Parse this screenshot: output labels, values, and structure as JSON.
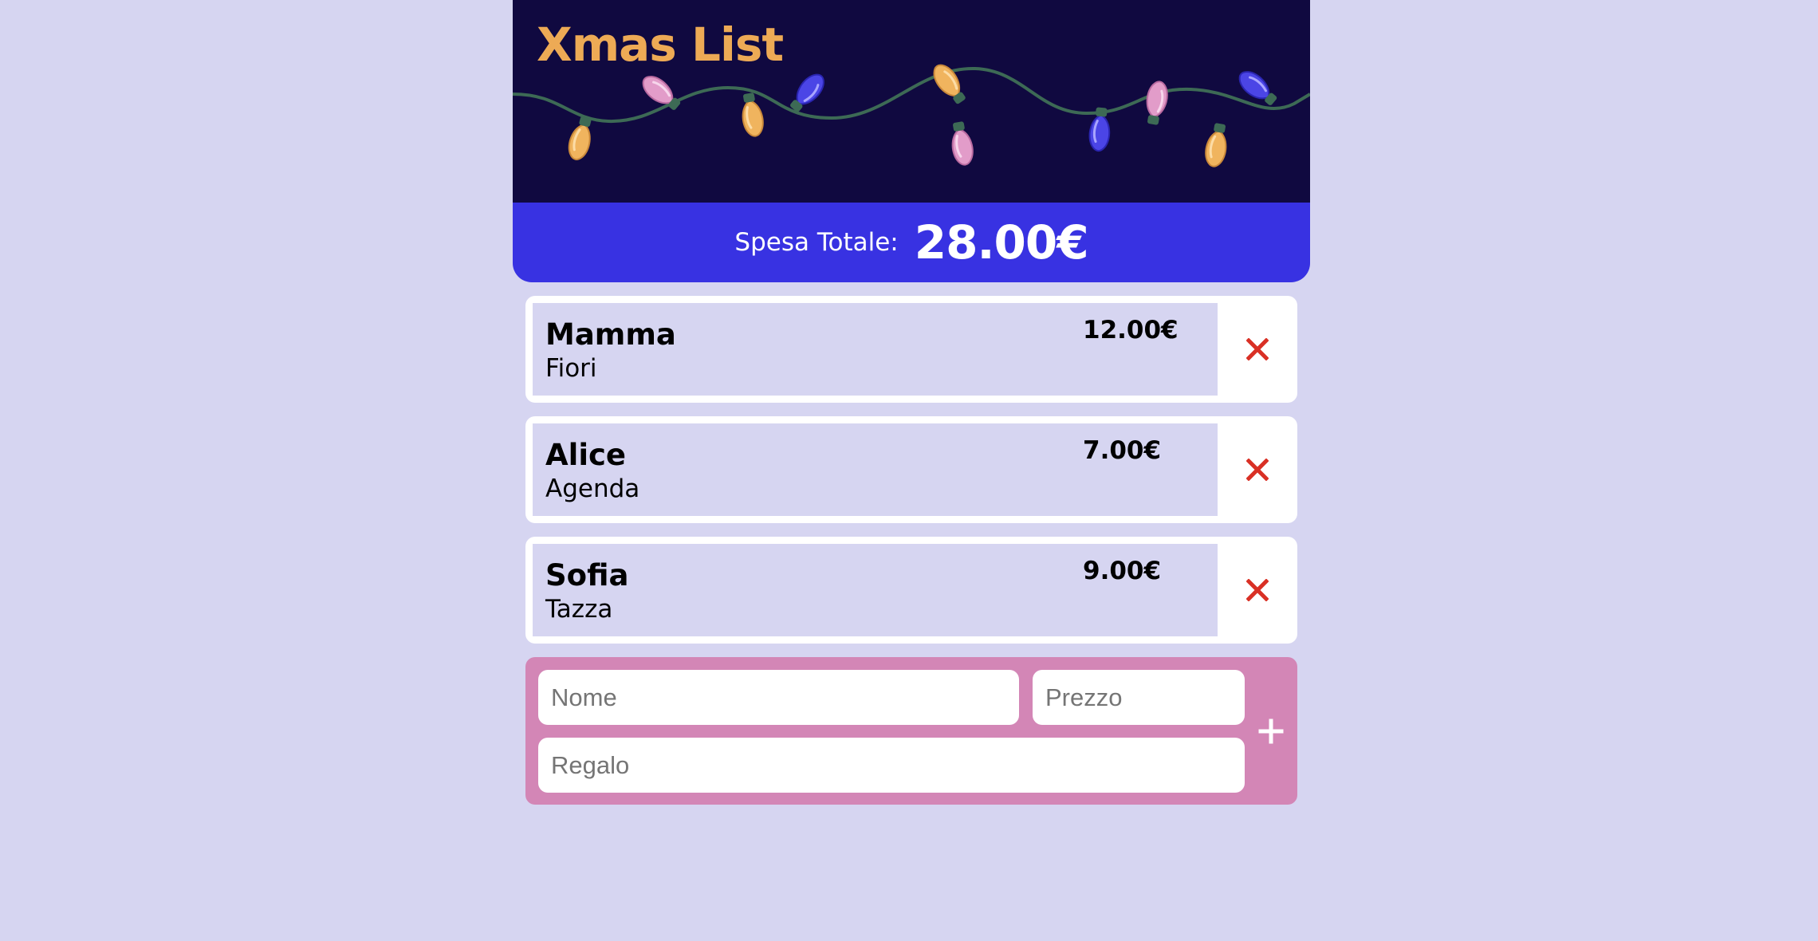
{
  "app": {
    "title": "Xmas List"
  },
  "total": {
    "label": "Spesa Totale:",
    "value": "28.00€"
  },
  "items": [
    {
      "name": "Mamma",
      "gift": "Fiori",
      "price": "12.00€"
    },
    {
      "name": "Alice",
      "gift": "Agenda",
      "price": "7.00€"
    },
    {
      "name": "Sofia",
      "gift": "Tazza",
      "price": "9.00€"
    }
  ],
  "form": {
    "name_placeholder": "Nome",
    "price_placeholder": "Prezzo",
    "gift_placeholder": "Regalo",
    "add_icon": "plus-icon"
  },
  "icons": {
    "delete": "close-icon",
    "add": "plus-icon"
  },
  "colors": {
    "page_background": "#d6d5f1",
    "header_background": "#100940",
    "title": "#edaa55",
    "total_bar": "#3832e2",
    "form_background": "#d386b6",
    "delete_icon": "#d93025",
    "wire": "#3d6a55",
    "bulb_yellow": "#f0b45e",
    "bulb_pink": "#e29cc9",
    "bulb_blue": "#4b45e6"
  }
}
